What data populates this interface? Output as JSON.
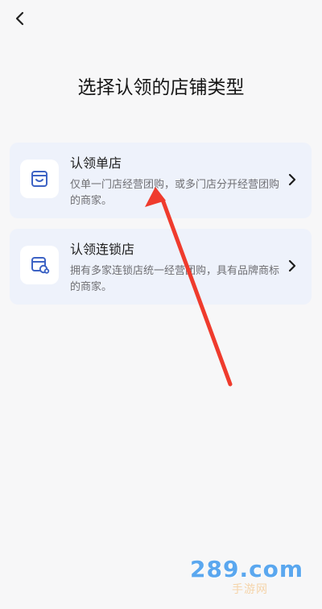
{
  "header": {
    "back_icon": "back-icon"
  },
  "page": {
    "title": "选择认领的店铺类型"
  },
  "options": [
    {
      "icon": "store-icon",
      "title": "认领单店",
      "description": "仅单一门店经营团购，或多门店分开经营团购的商家。"
    },
    {
      "icon": "chain-store-icon",
      "title": "认领连锁店",
      "description": "拥有多家连锁店统一经营团购，具有品牌商标的商家。"
    }
  ],
  "annotation": {
    "arrow_color": "#ef3b2d"
  },
  "watermark": {
    "main": "289.com",
    "sub": "手游网"
  },
  "colors": {
    "background": "#f7f7f8",
    "card_background": "#eef2fb",
    "icon_color": "#3d63c4"
  }
}
